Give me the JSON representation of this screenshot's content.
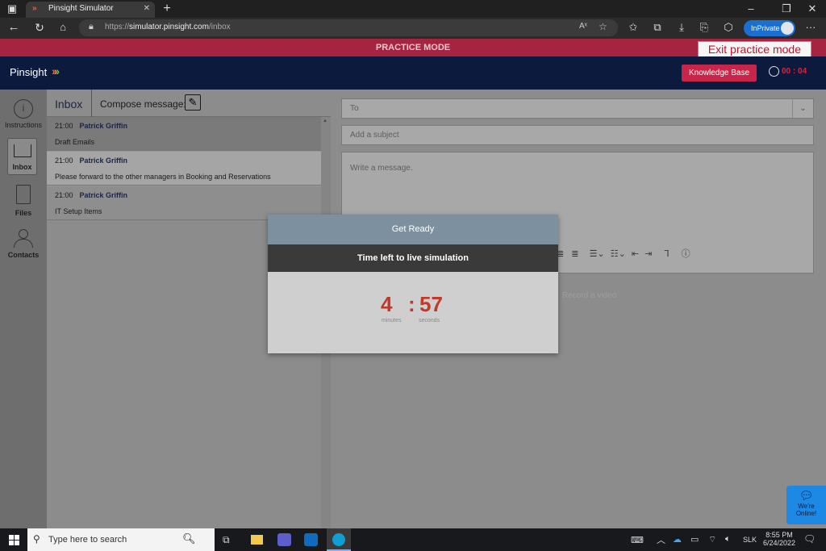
{
  "browser": {
    "tab_title": "Pinsight Simulator",
    "url_scheme": "https://",
    "url_host": "simulator.pinsight.com",
    "url_path": "/inbox",
    "inprivate_label": "InPrivate"
  },
  "banner": {
    "practice_label": "PRACTICE MODE",
    "exit_label": "Exit practice mode"
  },
  "header": {
    "logo_text": "Pinsight",
    "knowledge_base_label": "Knowledge Base",
    "timer_text": "00 : 04"
  },
  "sidebar": {
    "items": [
      {
        "label": "Instructions"
      },
      {
        "label": "Inbox"
      },
      {
        "label": "Files"
      },
      {
        "label": "Contacts"
      }
    ]
  },
  "inbox": {
    "title": "Inbox",
    "compose_label": "Compose message:",
    "messages": [
      {
        "time": "21:00",
        "from": "Patrick Griffin",
        "subject": "Draft Emails"
      },
      {
        "time": "21:00",
        "from": "Patrick Griffin",
        "subject": "Please forward to the other managers in Booking and Reservations"
      },
      {
        "time": "21:00",
        "from": "Patrick Griffin",
        "subject": "IT Setup Items"
      }
    ]
  },
  "compose": {
    "to_placeholder": "To",
    "subject_placeholder": "Add a subject",
    "message_placeholder": "Write a message.",
    "record_label": "Record a video"
  },
  "overlay": {
    "header": "Get Ready",
    "subheader": "Time left to live simulation",
    "minutes": "4",
    "separator": ":",
    "seconds": "57",
    "minutes_label": "minutes",
    "seconds_label": "seconds"
  },
  "chat": {
    "label_line1": "We're",
    "label_line2": "Online!"
  },
  "taskbar": {
    "search_placeholder": "Type here to search",
    "lang": "SLK",
    "time": "8:55 PM",
    "date": "6/24/2022"
  },
  "colors": {
    "accent_red": "#c8102e",
    "banner": "#a5243f",
    "header_navy": "#0c1a3d",
    "countdown_red": "#c0392b"
  }
}
